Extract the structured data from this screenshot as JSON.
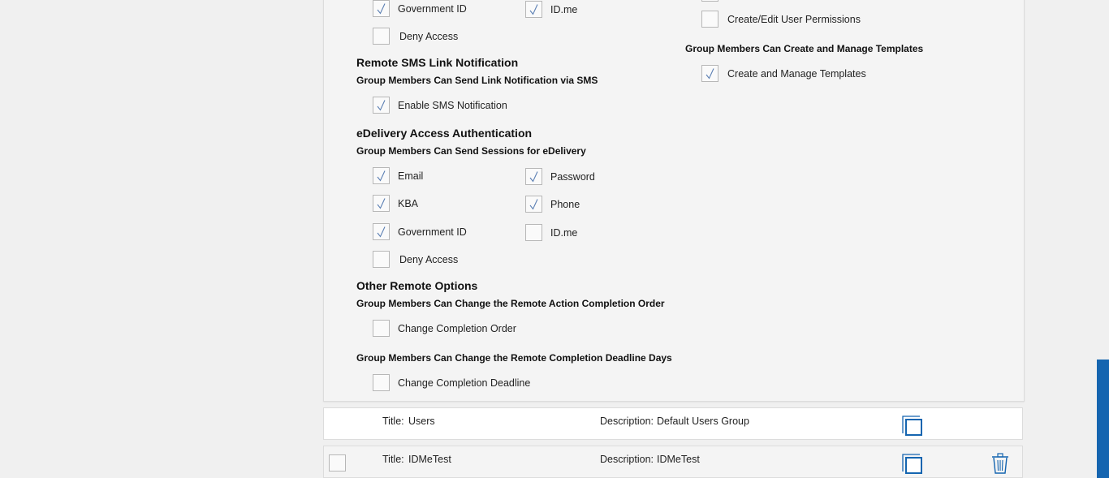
{
  "remote_auth": {
    "government_id": "Government ID",
    "idme": "ID.me",
    "deny_access": "Deny Access"
  },
  "permissions": {
    "create_edit_user_permissions": "Create/Edit User Permissions"
  },
  "templates": {
    "subtitle": "Group Members Can Create and Manage Templates",
    "option": "Create and Manage Templates"
  },
  "sms": {
    "title": "Remote SMS Link Notification",
    "subtitle": "Group Members Can Send Link Notification via SMS",
    "option": "Enable SMS Notification"
  },
  "edelivery": {
    "title": "eDelivery Access Authentication",
    "subtitle": "Group Members Can Send Sessions for eDelivery",
    "email": "Email",
    "password": "Password",
    "kba": "KBA",
    "phone": "Phone",
    "government_id": "Government ID",
    "idme": "ID.me",
    "deny_access": "Deny Access"
  },
  "other": {
    "title": "Other Remote Options",
    "order_subtitle": "Group Members Can Change the Remote Action Completion Order",
    "order_option": "Change Completion Order",
    "deadline_subtitle": "Group Members Can Change the Remote Completion Deadline Days",
    "deadline_option": "Change Completion Deadline"
  },
  "groups": [
    {
      "title_label": "Title:",
      "title": "Users",
      "description_label": "Description:",
      "description": "Default Users Group"
    },
    {
      "title_label": "Title:",
      "title": "IDMeTest",
      "description_label": "Description:",
      "description": "IDMeTest"
    }
  ],
  "colors": {
    "accent": "#1565b0",
    "check": "#5b7fb3"
  }
}
